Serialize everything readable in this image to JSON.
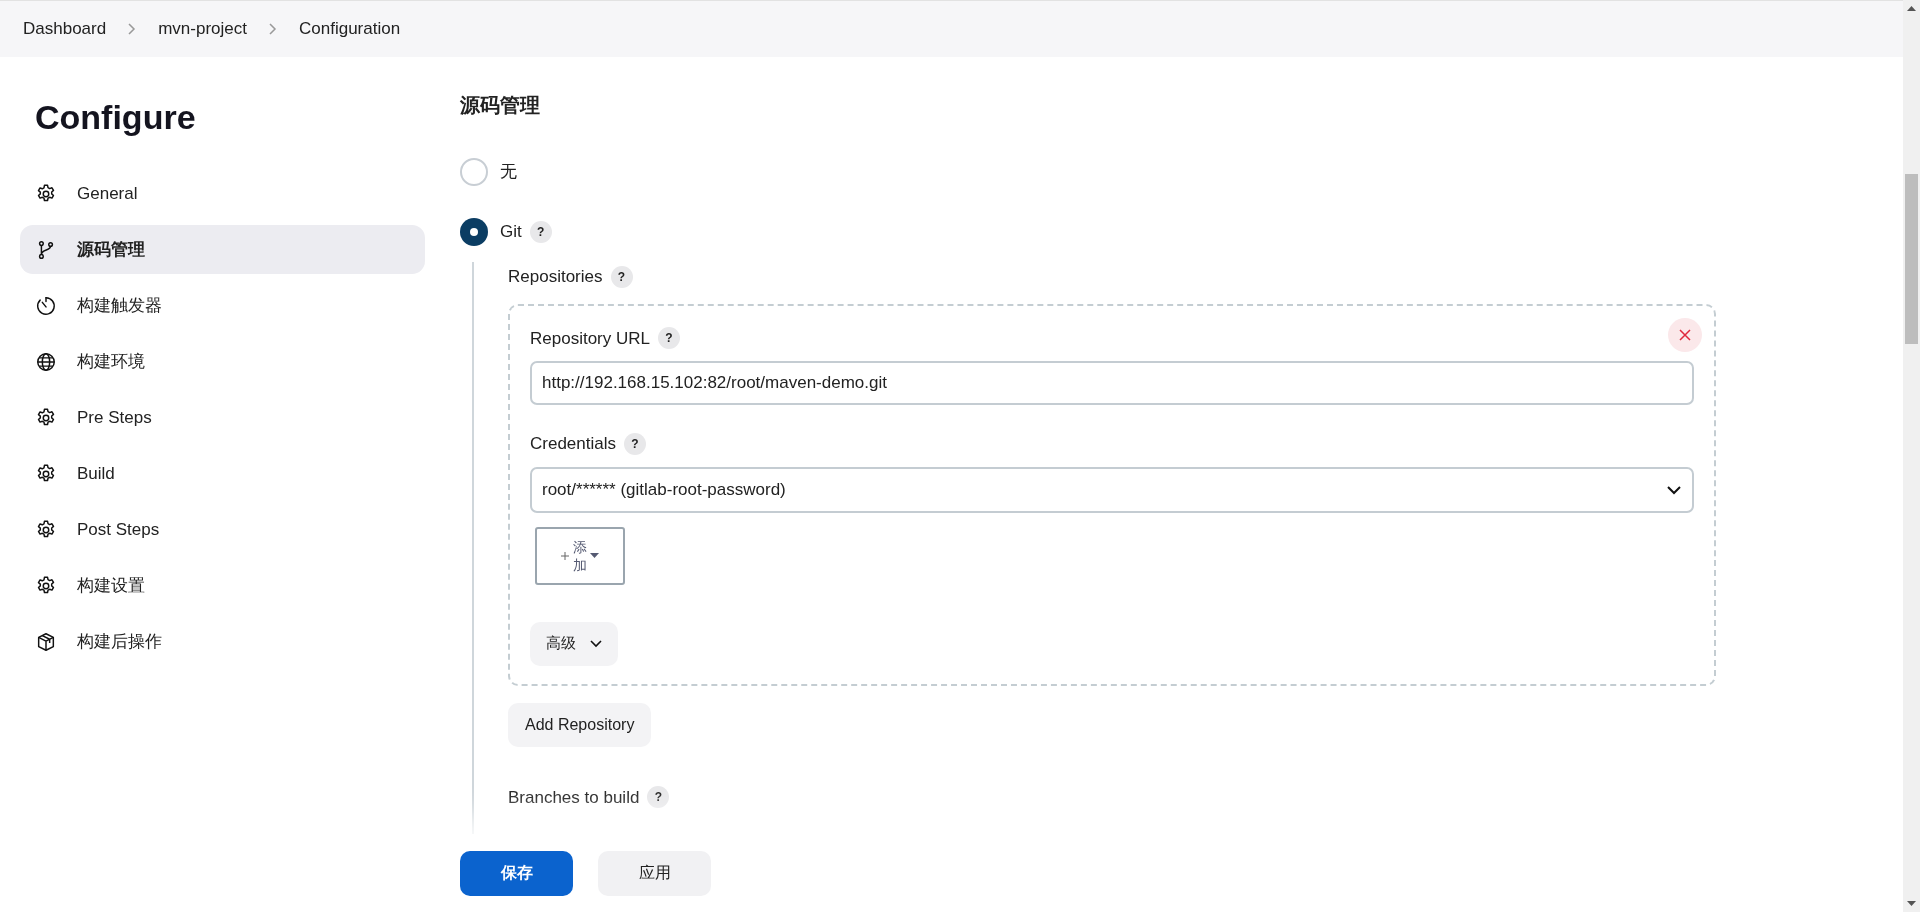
{
  "breadcrumbs": [
    "Dashboard",
    "mvn-project",
    "Configuration"
  ],
  "sidebar": {
    "title": "Configure",
    "items": [
      {
        "label": "General",
        "selected": false
      },
      {
        "label": "源码管理",
        "selected": true
      },
      {
        "label": "构建触发器",
        "selected": false
      },
      {
        "label": "构建环境",
        "selected": false
      },
      {
        "label": "Pre Steps",
        "selected": false
      },
      {
        "label": "Build",
        "selected": false
      },
      {
        "label": "Post Steps",
        "selected": false
      },
      {
        "label": "构建设置",
        "selected": false
      },
      {
        "label": "构建后操作",
        "selected": false
      }
    ]
  },
  "section": {
    "title": "源码管理",
    "options": [
      {
        "label": "无",
        "selected": false
      },
      {
        "label": "Git",
        "selected": true,
        "help": "?"
      }
    ],
    "repositories": {
      "label": "Repositories",
      "help": "?",
      "repository": {
        "url_label": "Repository URL",
        "url_help": "?",
        "url": "http://192.168.15.102:82/root/maven-demo.git",
        "credentials_label": "Credentials",
        "credentials_help": "?",
        "credentials": "root/****** (gitlab-root-password)",
        "add_button": "添加",
        "advanced_button": "高级"
      },
      "add_repository_button": "Add Repository"
    },
    "branches": {
      "label": "Branches to build",
      "help": "?"
    }
  },
  "footer": {
    "buttons": [
      {
        "label": "保存",
        "kind": "primary"
      },
      {
        "label": "应用",
        "kind": "secondary"
      }
    ]
  }
}
